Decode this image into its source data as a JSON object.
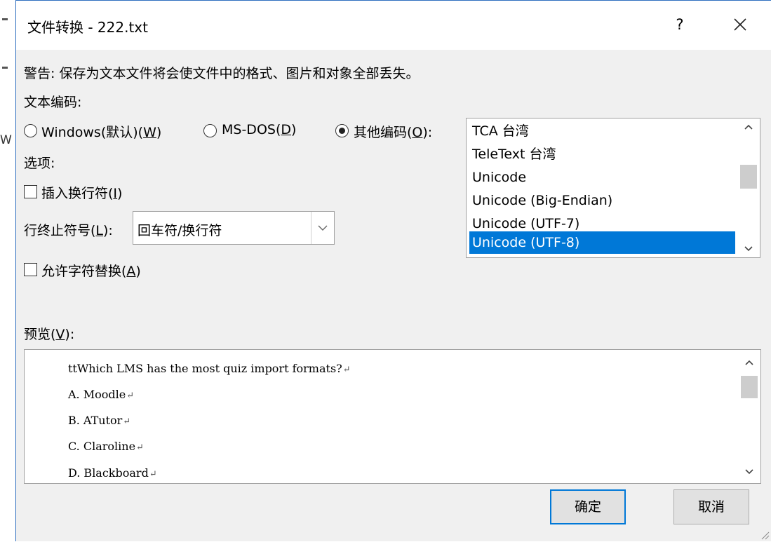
{
  "window": {
    "title": "文件转换 - 222.txt",
    "help_label": "?",
    "close_label": "close"
  },
  "background_doc": {
    "fragment": "W"
  },
  "warning": "警告: 保存为文本文件将会使文件中的格式、图片和对象全部丢失。",
  "encoding": {
    "label": "文本编码:",
    "options": [
      {
        "prefix": "Windows(默认)(",
        "key": "W",
        "suffix": ")",
        "selected": false
      },
      {
        "prefix": "MS-DOS(",
        "key": "D",
        "suffix": ")",
        "selected": false
      },
      {
        "prefix": "其他编码(",
        "key": "O",
        "suffix": "):",
        "selected": true
      }
    ],
    "list": {
      "items": [
        "TCA 台湾",
        "TeleText 台湾",
        "Unicode",
        "Unicode (Big-Endian)",
        "Unicode (UTF-7)",
        "Unicode (UTF-8)"
      ],
      "selected_index": 5
    }
  },
  "options": {
    "label": "选项:",
    "insert_line_breaks": {
      "prefix": "插入换行符(",
      "key": "I",
      "suffix": ")",
      "checked": false
    },
    "line_end": {
      "prefix": "行终止符号(",
      "key": "L",
      "suffix": "):",
      "value": "回车符/换行符"
    },
    "allow_substitution": {
      "prefix": "允许字符替换(",
      "key": "A",
      "suffix": ")",
      "checked": false
    }
  },
  "preview": {
    "prefix": "预览(",
    "key": "V",
    "suffix": "):",
    "lines": [
      "ttWhich LMS has the most quiz import formats?",
      "A. Moodle",
      "B. ATutor",
      "C. Claroline",
      "D. Blackboard"
    ],
    "line_end_mark": "↵"
  },
  "buttons": {
    "ok": "确定",
    "cancel": "取消"
  },
  "colors": {
    "selection": "#0078d7",
    "dialog_bg": "#f0f0f0"
  }
}
